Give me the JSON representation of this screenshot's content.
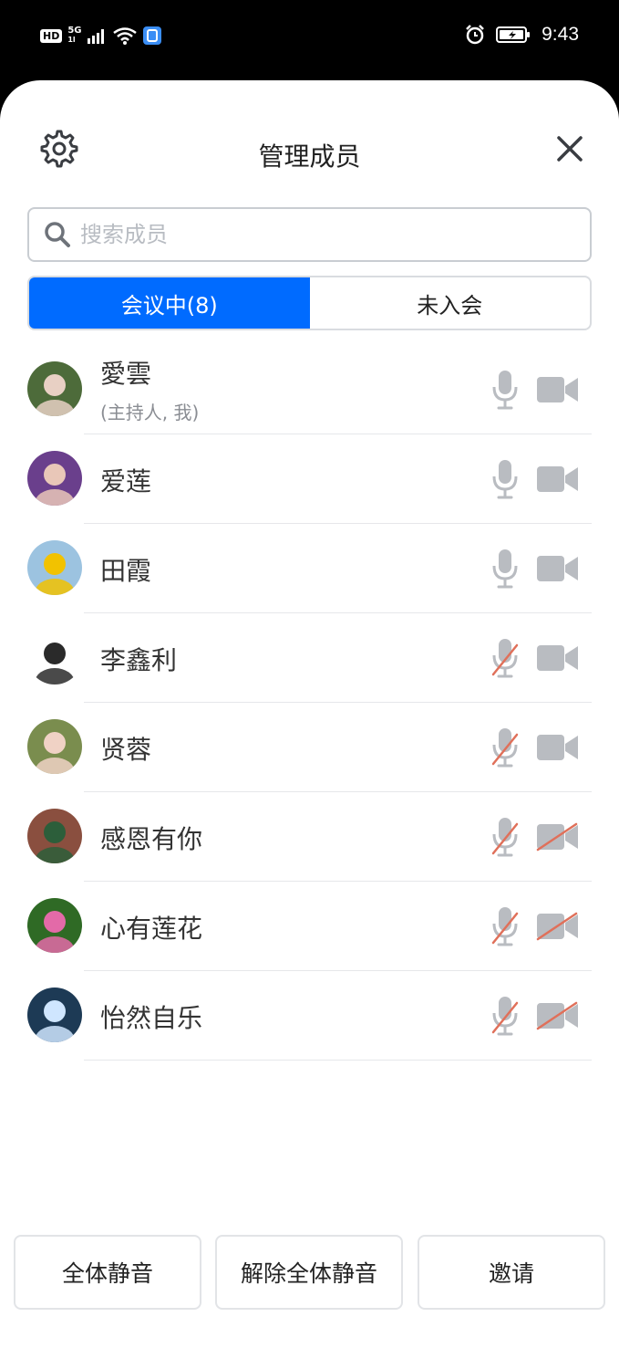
{
  "status": {
    "hd": "HD",
    "network_top": "5G",
    "network_bottom": "1l",
    "time": "9:43"
  },
  "header": {
    "title": "管理成员",
    "settings_icon": "gear-icon",
    "close_icon": "close-icon"
  },
  "search": {
    "placeholder": "搜索成员",
    "value": ""
  },
  "tabs": [
    {
      "label": "会议中(8)",
      "active": true
    },
    {
      "label": "未入会",
      "active": false
    }
  ],
  "members": [
    {
      "name": "愛雲",
      "subtitle": "(主持人, 我)",
      "mic_muted": false,
      "camera_off": false,
      "avatar_colors": [
        "#4d6b3a",
        "#e8d0c4"
      ]
    },
    {
      "name": "爱莲",
      "subtitle": "",
      "mic_muted": false,
      "camera_off": false,
      "avatar_colors": [
        "#6a3f8c",
        "#e9c7b8"
      ]
    },
    {
      "name": "田霞",
      "subtitle": "",
      "mic_muted": false,
      "camera_off": false,
      "avatar_colors": [
        "#9cc3e0",
        "#f2c200"
      ]
    },
    {
      "name": "李鑫利",
      "subtitle": "",
      "mic_muted": true,
      "camera_off": false,
      "avatar_colors": [
        "#ffffff",
        "#2a2a2a"
      ]
    },
    {
      "name": "贤蓉",
      "subtitle": "",
      "mic_muted": true,
      "camera_off": false,
      "avatar_colors": [
        "#7a8d4e",
        "#f0d2c5"
      ]
    },
    {
      "name": "感恩有你",
      "subtitle": "",
      "mic_muted": true,
      "camera_off": true,
      "avatar_colors": [
        "#8a4f3f",
        "#2c5e3a"
      ]
    },
    {
      "name": "心有莲花",
      "subtitle": "",
      "mic_muted": true,
      "camera_off": true,
      "avatar_colors": [
        "#2f6a25",
        "#e36aa8"
      ]
    },
    {
      "name": "怡然自乐",
      "subtitle": "",
      "mic_muted": true,
      "camera_off": true,
      "avatar_colors": [
        "#1d3a55",
        "#cfe6ff"
      ]
    }
  ],
  "footer": {
    "mute_all": "全体静音",
    "unmute_all": "解除全体静音",
    "invite": "邀请"
  },
  "colors": {
    "accent": "#006bff",
    "icon_gray": "#b9bcc1",
    "muted_slash": "#e0705a"
  }
}
